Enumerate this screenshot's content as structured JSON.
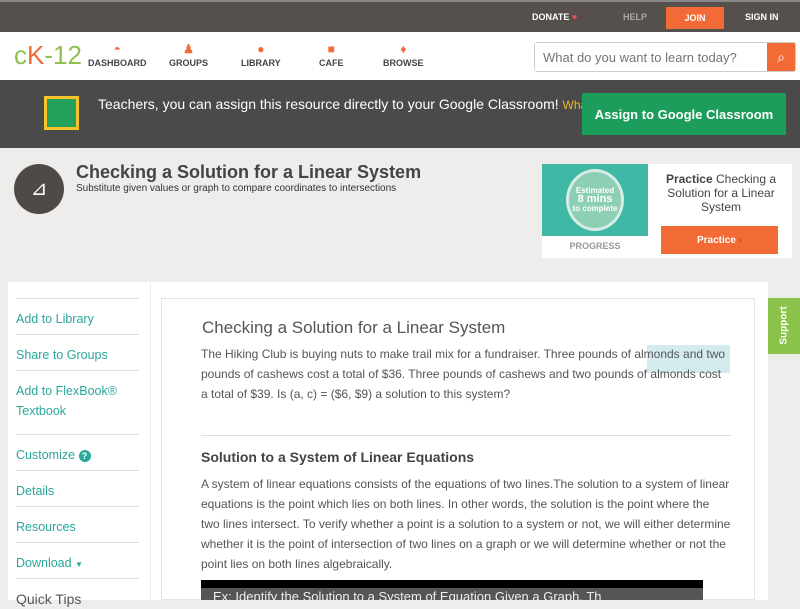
{
  "topbar": {
    "donate": "DONATE",
    "help": "HELP",
    "join": "JOIN",
    "signin": "SIGN IN"
  },
  "nav": {
    "logo": "cK-12",
    "items": [
      {
        "label": "DASHBOARD",
        "icon": "dashboard-icon"
      },
      {
        "label": "GROUPS",
        "icon": "groups-icon"
      },
      {
        "label": "LIBRARY",
        "icon": "library-icon"
      },
      {
        "label": "CAFE",
        "icon": "cafe-icon"
      },
      {
        "label": "BROWSE",
        "icon": "browse-icon"
      }
    ],
    "search_placeholder": "What do you want to learn today?"
  },
  "banner": {
    "text": "Teachers, you can assign this resource directly to your Google Classroom!",
    "link": "What is this?",
    "button": "Assign to Google Classroom"
  },
  "concept": {
    "title": "Checking a Solution for a Linear System",
    "subtitle": "Substitute given values or graph to compare coordinates to intersections"
  },
  "practice": {
    "estimated": "Estimated",
    "mins": "8 mins",
    "complete": "to complete",
    "progress": "PROGRESS",
    "bold": "Practice",
    "text": "Checking a Solution for a Linear System",
    "button": "Practice"
  },
  "sidebar": {
    "items": [
      "Add to Library",
      "Share to Groups",
      "Add to FlexBook® Textbook",
      "Customize",
      "Details",
      "Resources",
      "Download",
      "Quick Tips"
    ]
  },
  "content": {
    "heading": "Checking a Solution for a Linear System",
    "intro": "The Hiking Club is buying nuts to make trail mix for a fundraiser. Three pounds of almonds and two pounds of cashews cost a total of $36. Three pounds of cashews and two pounds of almonds cost a total of $39. Is (a, c) = ($6, $9) a solution to this system?",
    "section": "Solution to a System of Linear Equations",
    "body": "A system of linear equations consists of the equations of two lines.The solution to a system of linear equations is the point which lies on both lines. In other words, the solution is the point where the two lines intersect. To verify whether a point is a solution to a system or not, we will either determine whether it is the point of intersection of two lines on a graph or we will determine whether or not the point lies on both lines algebraically.",
    "video_title": "Ex: Identify the Solution to a System of Equation Given a Graph, Th"
  },
  "support": "Support"
}
